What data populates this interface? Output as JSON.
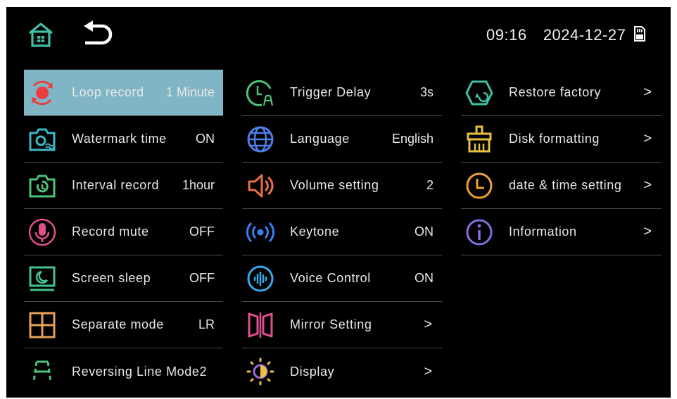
{
  "header": {
    "home_icon": "home-icon",
    "back_icon": "back-arrow-icon",
    "time": "09:16",
    "date": "2024-12-27",
    "sd_icon": "sd-card-icon"
  },
  "columns": {
    "left": [
      {
        "label": "Loop record",
        "value": "1 Minute",
        "icon": "loop-record-icon",
        "color": "#e84040",
        "selected": true
      },
      {
        "label": "Watermark time",
        "value": "ON",
        "icon": "watermark-camera-icon",
        "color": "#3fb7c8"
      },
      {
        "label": "Interval record",
        "value": "1hour",
        "icon": "interval-camera-icon",
        "color": "#4cc27a"
      },
      {
        "label": "Record mute",
        "value": "OFF",
        "icon": "microphone-icon",
        "color": "#e0508c"
      },
      {
        "label": "Screen sleep",
        "value": "OFF",
        "icon": "screen-sleep-icon",
        "color": "#45c28c"
      },
      {
        "label": "Separate mode",
        "value": "LR",
        "icon": "grid-icon",
        "color": "#e8a05a"
      },
      {
        "label": "Reversing Line Mode2",
        "value": "",
        "icon": "reversing-line-icon",
        "color": "#4cc27a"
      }
    ],
    "middle": [
      {
        "label": "Trigger Delay",
        "value": "3s",
        "icon": "trigger-delay-icon",
        "color": "#4cc27a"
      },
      {
        "label": "Language",
        "value": "English",
        "icon": "globe-icon",
        "color": "#4f7ee8"
      },
      {
        "label": "Volume setting",
        "value": "2",
        "icon": "volume-icon",
        "color": "#e8704a"
      },
      {
        "label": "Keytone",
        "value": "ON",
        "icon": "keytone-icon",
        "color": "#3a7ff0"
      },
      {
        "label": "Voice Control",
        "value": "ON",
        "icon": "voice-control-icon",
        "color": "#3aa8e8"
      },
      {
        "label": "Mirror Setting",
        "value": "",
        "chevron": ">",
        "icon": "mirror-icon",
        "color": "#e05090"
      },
      {
        "label": "Display",
        "value": "",
        "chevron": ">",
        "icon": "brightness-icon",
        "color": "#9b6be0"
      }
    ],
    "right": [
      {
        "label": "Restore factory",
        "value": "",
        "chevron": ">",
        "icon": "restore-factory-icon",
        "color": "#3fc0a8"
      },
      {
        "label": "Disk formatting",
        "value": "",
        "chevron": ">",
        "icon": "broom-icon",
        "color": "#e8c040"
      },
      {
        "label": "date & time setting",
        "value": "",
        "chevron": ">",
        "icon": "clock-icon",
        "color": "#f0a030"
      },
      {
        "label": "Information",
        "value": "",
        "chevron": ">",
        "icon": "info-icon",
        "color": "#8a6be0"
      }
    ]
  },
  "colors": {
    "selected_bg": "#7fb5c4",
    "background": "#000000",
    "home": "#3fc0a8"
  }
}
